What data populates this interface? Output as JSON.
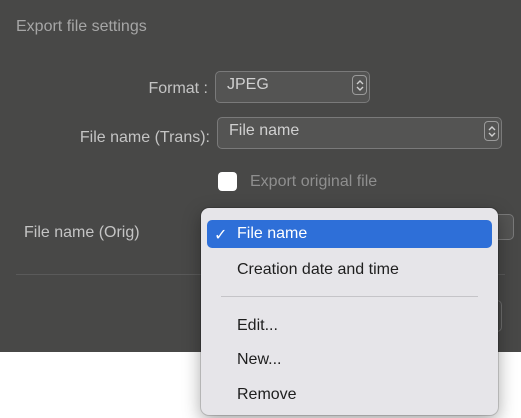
{
  "panel": {
    "title": "Export file settings"
  },
  "format": {
    "label": "Format :",
    "value": "JPEG"
  },
  "file_name_trans": {
    "label": "File name (Trans):",
    "value": "File name"
  },
  "export_original": {
    "label": "Export original file",
    "checked": false
  },
  "file_name_orig": {
    "label": "File name (Orig)"
  },
  "menu": {
    "check_glyph": "✓",
    "items": [
      {
        "label": "File name",
        "selected": true
      },
      {
        "label": "Creation date and time",
        "selected": false
      },
      {
        "label": "Edit...",
        "selected": false
      },
      {
        "label": "New...",
        "selected": false
      },
      {
        "label": "Remove",
        "selected": false
      }
    ]
  },
  "colors": {
    "panel_bg": "#484847",
    "menu_bg": "#e6e5e9",
    "selection": "#2e6fd8"
  }
}
